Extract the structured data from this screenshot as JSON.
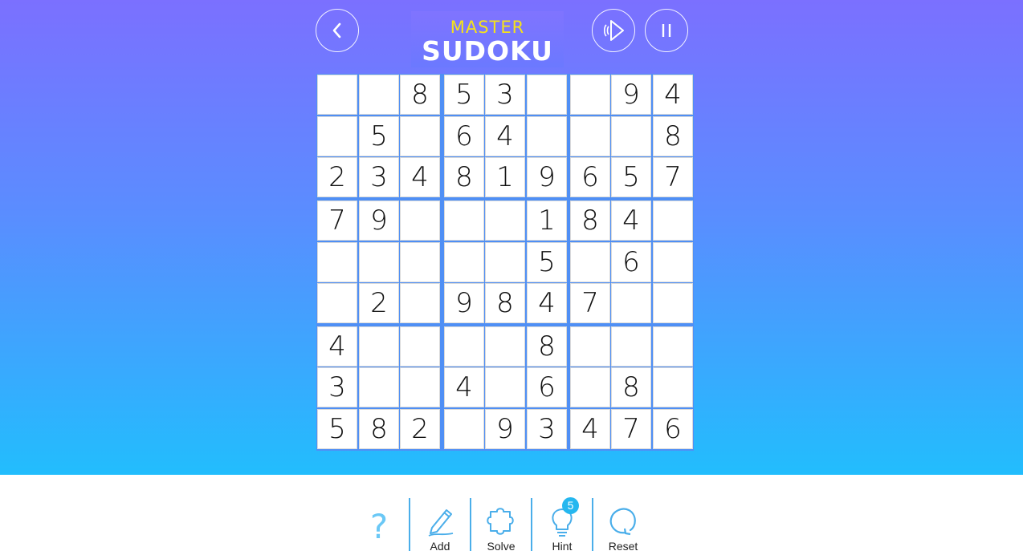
{
  "header": {
    "logo_top": "MASTER",
    "logo_main": "SUDOKU",
    "back_icon": "chevron-left-icon",
    "sound_icon": "speaker-icon",
    "pause_icon": "pause-icon"
  },
  "board": {
    "rows": [
      [
        "",
        "",
        "8",
        "5",
        "3",
        "",
        "",
        "9",
        "4"
      ],
      [
        "",
        "5",
        "",
        "6",
        "4",
        "",
        "",
        "",
        "8"
      ],
      [
        "2",
        "3",
        "4",
        "8",
        "1",
        "9",
        "6",
        "5",
        "7"
      ],
      [
        "7",
        "9",
        "",
        "",
        "",
        "1",
        "8",
        "4",
        ""
      ],
      [
        "",
        "",
        "",
        "",
        "",
        "5",
        "",
        "6",
        ""
      ],
      [
        "",
        "2",
        "",
        "9",
        "8",
        "4",
        "7",
        "",
        ""
      ],
      [
        "4",
        "",
        "",
        "",
        "",
        "8",
        "",
        "",
        ""
      ],
      [
        "3",
        "",
        "",
        "4",
        "",
        "6",
        "",
        "8",
        ""
      ],
      [
        "5",
        "8",
        "2",
        "",
        "9",
        "3",
        "4",
        "7",
        "6"
      ]
    ]
  },
  "toolbar": {
    "help_label": "?",
    "add_label": "Add",
    "solve_label": "Solve",
    "hint_label": "Hint",
    "hint_count": "5",
    "reset_label": "Reset",
    "accent_color": "#4aaeea"
  },
  "colors": {
    "gradient_top": "#7b70ff",
    "gradient_bottom": "#22bdfd",
    "board_border": "#4f8ff5",
    "logo_accent": "#f5e21b"
  }
}
